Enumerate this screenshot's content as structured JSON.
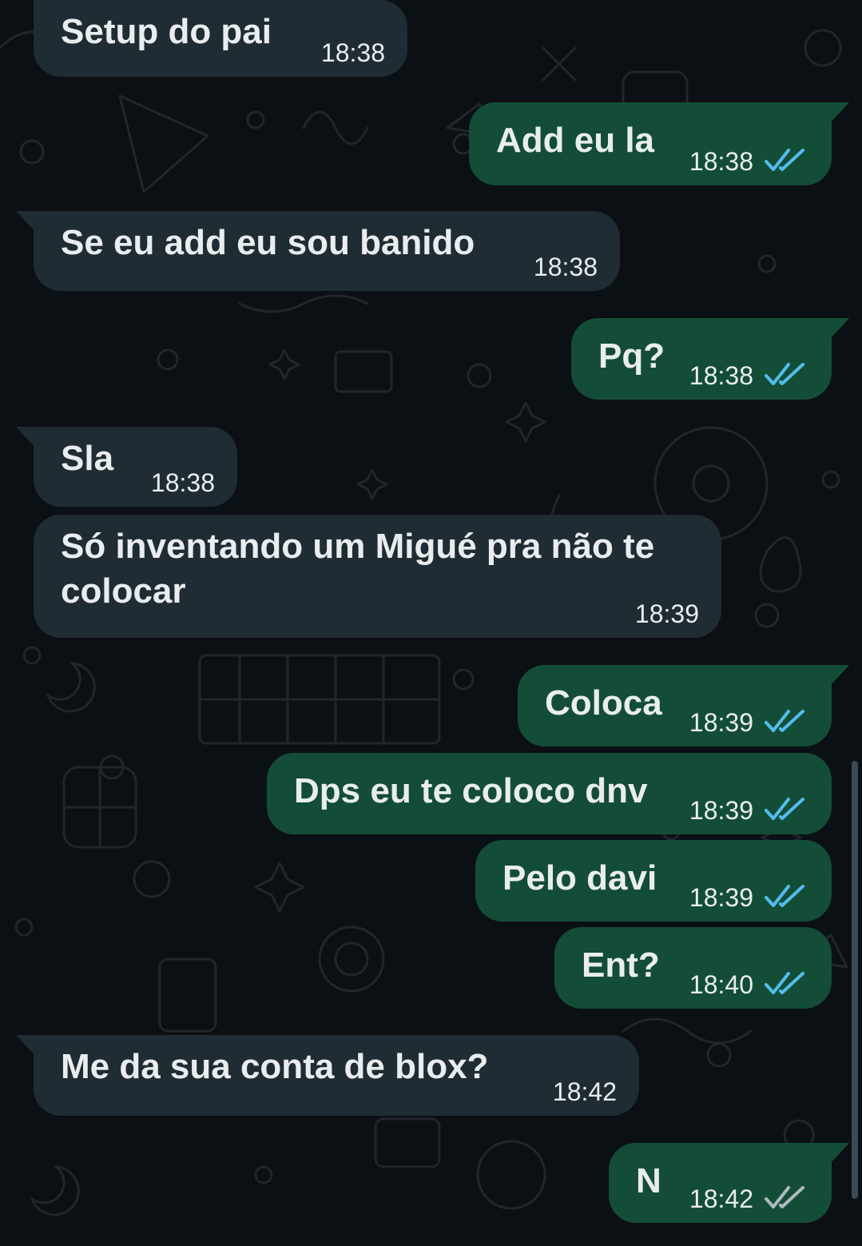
{
  "theme": {
    "background": "#0b1014",
    "incoming_bubble": "#202c33",
    "outgoing_bubble": "#144d37",
    "text_color": "#e9edef",
    "read_tick_color": "#53bdeb",
    "delivered_tick_color": "#aebac1"
  },
  "messages": [
    {
      "direction": "incoming",
      "text": "Setup do pai",
      "time": "18:38"
    },
    {
      "direction": "outgoing",
      "text": "Add eu la",
      "time": "18:38",
      "status": "read"
    },
    {
      "direction": "incoming",
      "text": "Se eu add eu sou banido",
      "time": "18:38"
    },
    {
      "direction": "outgoing",
      "text": "Pq?",
      "time": "18:38",
      "status": "read"
    },
    {
      "direction": "incoming",
      "text": "Sla",
      "time": "18:38"
    },
    {
      "direction": "incoming",
      "text": "Só inventando um Migué pra não te colocar",
      "time": "18:39"
    },
    {
      "direction": "outgoing",
      "text": "Coloca",
      "time": "18:39",
      "status": "read"
    },
    {
      "direction": "outgoing",
      "text": "Dps eu te coloco dnv",
      "time": "18:39",
      "status": "read"
    },
    {
      "direction": "outgoing",
      "text": "Pelo davi",
      "time": "18:39",
      "status": "read"
    },
    {
      "direction": "outgoing",
      "text": "Ent?",
      "time": "18:40",
      "status": "read"
    },
    {
      "direction": "incoming",
      "text": "Me da sua conta de blox?",
      "time": "18:42"
    },
    {
      "direction": "outgoing",
      "text": "N",
      "time": "18:42",
      "status": "delivered"
    }
  ]
}
